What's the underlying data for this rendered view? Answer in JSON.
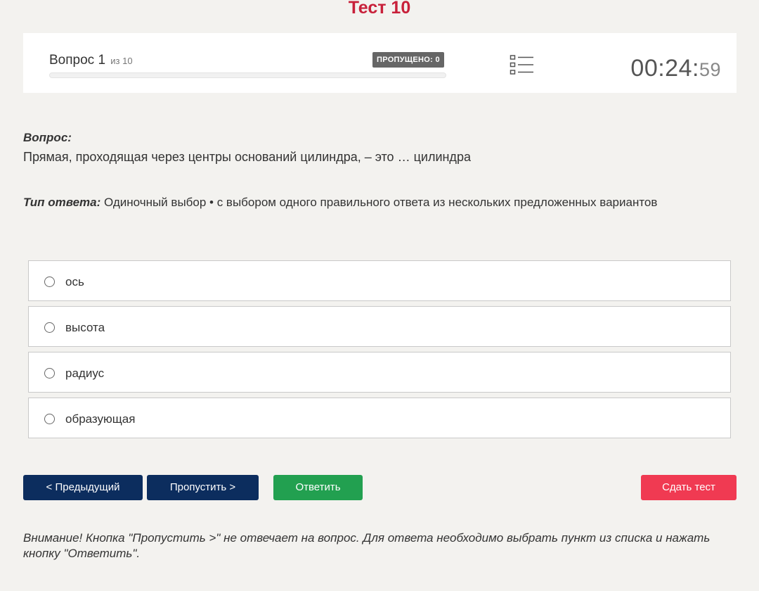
{
  "page": {
    "title": "Тест 10"
  },
  "header": {
    "question_label": "Вопрос 1",
    "question_total": "из 10",
    "skipped_badge": "ПРОПУЩЕНО: 0",
    "progress_fraction": 0.0,
    "list_icon": "list-icon",
    "timer_main": "00:24:",
    "timer_seconds": "59"
  },
  "question": {
    "label": "Вопрос:",
    "text": "Прямая, проходящая через центры оснований цилиндра, – это … цилиндра",
    "answer_type_label": "Тип ответа:",
    "answer_type_text": " Одиночный выбор • с выбором одного правильного ответа из нескольких предложенных вариантов"
  },
  "options": [
    {
      "label": "ось"
    },
    {
      "label": "высота"
    },
    {
      "label": "радиус"
    },
    {
      "label": "образующая"
    }
  ],
  "buttons": {
    "prev": "< Предыдущий",
    "skip": "Пропустить >",
    "answer": "Ответить",
    "submit": "Сдать тест"
  },
  "warning": "Внимание! Кнопка \"Пропустить >\" не отвечает на вопрос. Для ответа необходимо выбрать пункт из списка и нажать кнопку \"Ответить\".",
  "colors": {
    "accent": "#c8203a",
    "primary_button": "#0c2d5e",
    "answer_button": "#22a050",
    "submit_button": "#f03a52"
  }
}
